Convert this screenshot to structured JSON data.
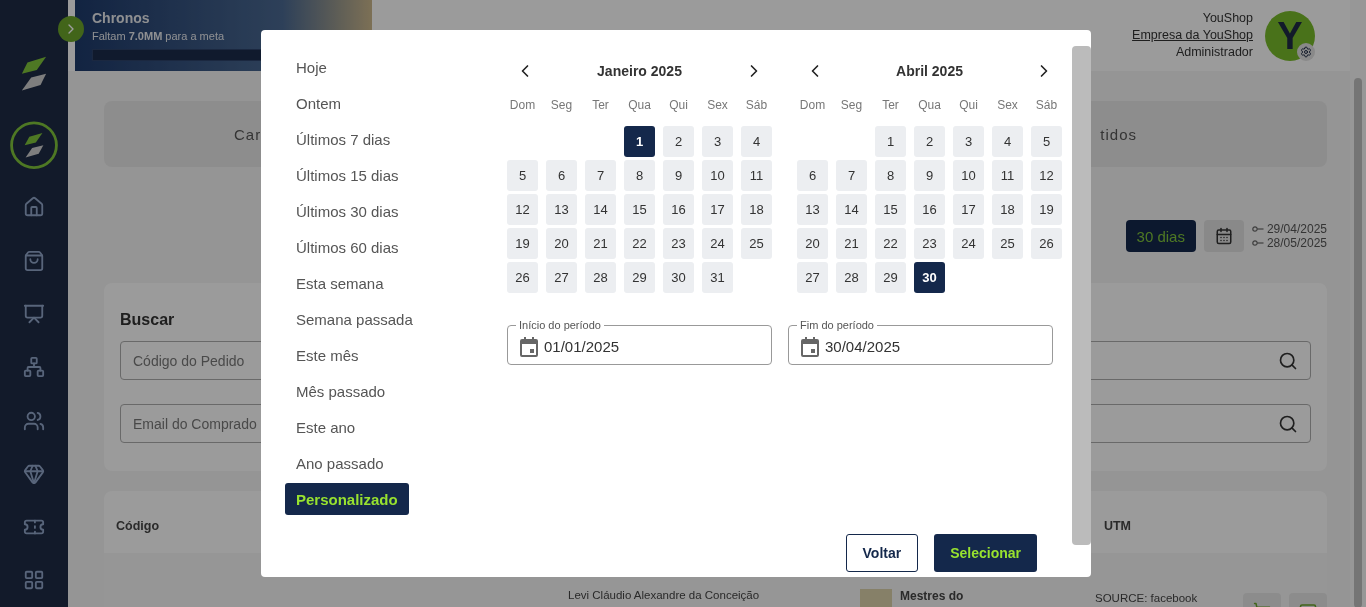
{
  "banner": {
    "title": "Chronos",
    "subtitle": "Faltam **7.0MM** para a meta",
    "level": 0
  },
  "user": {
    "name": "YouShop",
    "company": "Empresa da YouShop",
    "role": "Administrador",
    "avatar_letter": "Y"
  },
  "tab_labels": [
    "Car",
    "tidos"
  ],
  "period": {
    "active_label": "30 dias",
    "start": "29/04/2025",
    "end": "28/05/2025"
  },
  "search": {
    "title": "Buscar",
    "fields": [
      {
        "placeholder": "Código do Pedido"
      },
      {
        "placeholder": "Email do Comprado"
      }
    ]
  },
  "table": {
    "columns": [
      "Código",
      "UTM"
    ],
    "row": {
      "customer": "Levi Cláudio Alexandre da Conceição",
      "product": "Mestres do",
      "utm": "SOURCE: facebook"
    }
  },
  "modal": {
    "presets": [
      {
        "label": "Hoje",
        "selected": false
      },
      {
        "label": "Ontem",
        "selected": false
      },
      {
        "label": "Últimos 7 dias",
        "selected": false
      },
      {
        "label": "Últimos 15 dias",
        "selected": false
      },
      {
        "label": "Últimos 30 dias",
        "selected": false
      },
      {
        "label": "Últimos 60 dias",
        "selected": false
      },
      {
        "label": "Esta semana",
        "selected": false
      },
      {
        "label": "Semana passada",
        "selected": false
      },
      {
        "label": "Este mês",
        "selected": false
      },
      {
        "label": "Mês passado",
        "selected": false
      },
      {
        "label": "Este ano",
        "selected": false
      },
      {
        "label": "Ano passado",
        "selected": false
      },
      {
        "label": "Personalizado",
        "selected": true
      }
    ],
    "calendars": [
      {
        "title": "Janeiro 2025",
        "weekdays": [
          "Dom",
          "Seg",
          "Ter",
          "Qua",
          "Qui",
          "Sex",
          "Sáb"
        ],
        "weeks": [
          [
            {
              "kind": "blank"
            },
            {
              "kind": "blank"
            },
            {
              "kind": "blank"
            },
            {
              "kind": "day",
              "label": "1",
              "selected": true
            },
            {
              "kind": "day",
              "label": "2",
              "selected": false
            },
            {
              "kind": "day",
              "label": "3",
              "selected": false
            },
            {
              "kind": "day",
              "label": "4",
              "selected": false
            }
          ],
          [
            {
              "kind": "day",
              "label": "5",
              "selected": false
            },
            {
              "kind": "day",
              "label": "6",
              "selected": false
            },
            {
              "kind": "day",
              "label": "7",
              "selected": false
            },
            {
              "kind": "day",
              "label": "8",
              "selected": false
            },
            {
              "kind": "day",
              "label": "9",
              "selected": false
            },
            {
              "kind": "day",
              "label": "10",
              "selected": false
            },
            {
              "kind": "day",
              "label": "11",
              "selected": false
            }
          ],
          [
            {
              "kind": "day",
              "label": "12",
              "selected": false
            },
            {
              "kind": "day",
              "label": "13",
              "selected": false
            },
            {
              "kind": "day",
              "label": "14",
              "selected": false
            },
            {
              "kind": "day",
              "label": "15",
              "selected": false
            },
            {
              "kind": "day",
              "label": "16",
              "selected": false
            },
            {
              "kind": "day",
              "label": "17",
              "selected": false
            },
            {
              "kind": "day",
              "label": "18",
              "selected": false
            }
          ],
          [
            {
              "kind": "day",
              "label": "19",
              "selected": false
            },
            {
              "kind": "day",
              "label": "20",
              "selected": false
            },
            {
              "kind": "day",
              "label": "21",
              "selected": false
            },
            {
              "kind": "day",
              "label": "22",
              "selected": false
            },
            {
              "kind": "day",
              "label": "23",
              "selected": false
            },
            {
              "kind": "day",
              "label": "24",
              "selected": false
            },
            {
              "kind": "day",
              "label": "25",
              "selected": false
            }
          ],
          [
            {
              "kind": "day",
              "label": "26",
              "selected": false
            },
            {
              "kind": "day",
              "label": "27",
              "selected": false
            },
            {
              "kind": "day",
              "label": "28",
              "selected": false
            },
            {
              "kind": "day",
              "label": "29",
              "selected": false
            },
            {
              "kind": "day",
              "label": "30",
              "selected": false
            },
            {
              "kind": "day",
              "label": "31",
              "selected": false
            },
            {
              "kind": "blank"
            }
          ]
        ]
      },
      {
        "title": "Abril 2025",
        "weekdays": [
          "Dom",
          "Seg",
          "Ter",
          "Qua",
          "Qui",
          "Sex",
          "Sáb"
        ],
        "weeks": [
          [
            {
              "kind": "blank"
            },
            {
              "kind": "blank"
            },
            {
              "kind": "day",
              "label": "1",
              "selected": false
            },
            {
              "kind": "day",
              "label": "2",
              "selected": false
            },
            {
              "kind": "day",
              "label": "3",
              "selected": false
            },
            {
              "kind": "day",
              "label": "4",
              "selected": false
            },
            {
              "kind": "day",
              "label": "5",
              "selected": false
            }
          ],
          [
            {
              "kind": "day",
              "label": "6",
              "selected": false
            },
            {
              "kind": "day",
              "label": "7",
              "selected": false
            },
            {
              "kind": "day",
              "label": "8",
              "selected": false
            },
            {
              "kind": "day",
              "label": "9",
              "selected": false
            },
            {
              "kind": "day",
              "label": "10",
              "selected": false
            },
            {
              "kind": "day",
              "label": "11",
              "selected": false
            },
            {
              "kind": "day",
              "label": "12",
              "selected": false
            }
          ],
          [
            {
              "kind": "day",
              "label": "13",
              "selected": false
            },
            {
              "kind": "day",
              "label": "14",
              "selected": false
            },
            {
              "kind": "day",
              "label": "15",
              "selected": false
            },
            {
              "kind": "day",
              "label": "16",
              "selected": false
            },
            {
              "kind": "day",
              "label": "17",
              "selected": false
            },
            {
              "kind": "day",
              "label": "18",
              "selected": false
            },
            {
              "kind": "day",
              "label": "19",
              "selected": false
            }
          ],
          [
            {
              "kind": "day",
              "label": "20",
              "selected": false
            },
            {
              "kind": "day",
              "label": "21",
              "selected": false
            },
            {
              "kind": "day",
              "label": "22",
              "selected": false
            },
            {
              "kind": "day",
              "label": "23",
              "selected": false
            },
            {
              "kind": "day",
              "label": "24",
              "selected": false
            },
            {
              "kind": "day",
              "label": "25",
              "selected": false
            },
            {
              "kind": "day",
              "label": "26",
              "selected": false
            }
          ],
          [
            {
              "kind": "day",
              "label": "27",
              "selected": false
            },
            {
              "kind": "day",
              "label": "28",
              "selected": false
            },
            {
              "kind": "day",
              "label": "29",
              "selected": false
            },
            {
              "kind": "day",
              "label": "30",
              "selected": true
            },
            {
              "kind": "blank"
            },
            {
              "kind": "blank"
            },
            {
              "kind": "blank"
            }
          ]
        ]
      }
    ],
    "fields": [
      {
        "label": "Início do período",
        "value": "01/01/2025"
      },
      {
        "label": "Fim do período",
        "value": "30/04/2025"
      }
    ],
    "buttons": [
      {
        "label": "Voltar",
        "kind": "secondary"
      },
      {
        "label": "Selecionar",
        "kind": "primary"
      }
    ]
  }
}
